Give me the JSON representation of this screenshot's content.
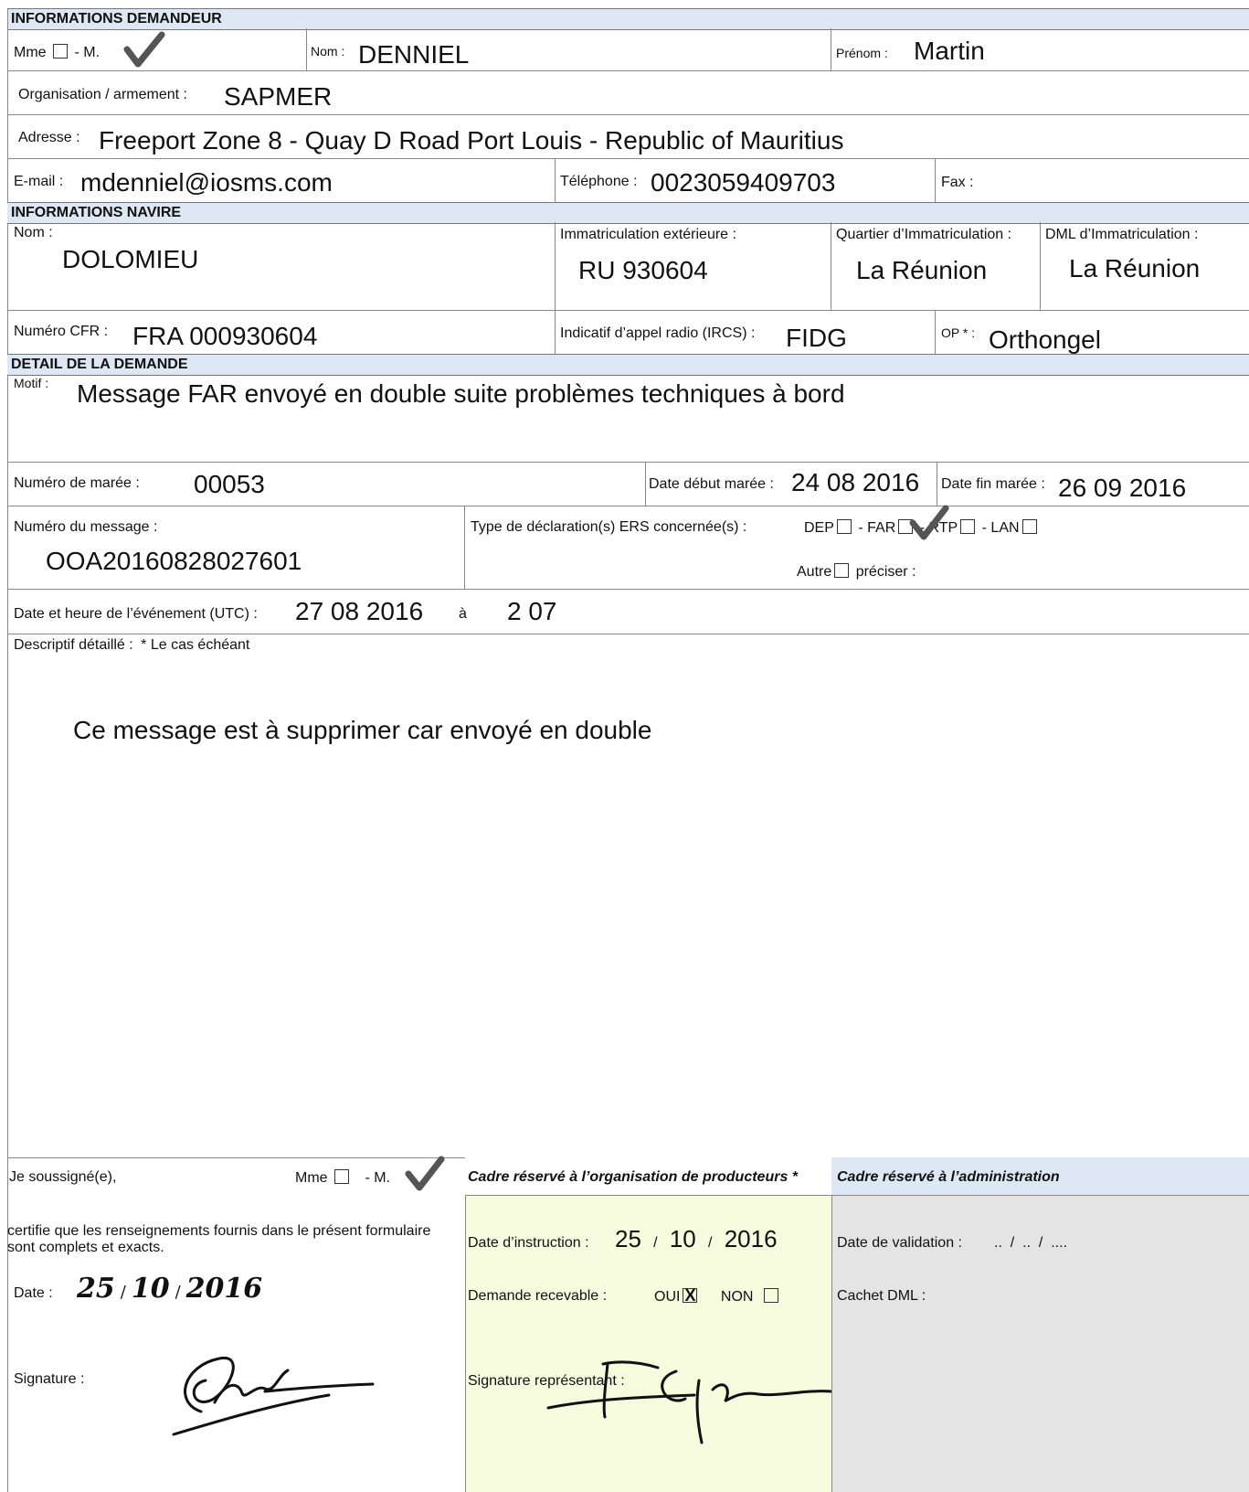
{
  "sections": {
    "demandeur": "INFORMATIONS DEMANDEUR",
    "navire": "INFORMATIONS NAVIRE",
    "demande": "DETAIL DE LA DEMANDE"
  },
  "demandeur": {
    "mme_label": "Mme",
    "m_label": "- M.",
    "nom_label": "Nom :",
    "nom": "DENNIEL",
    "prenom_label": "Prénom :",
    "prenom": "Martin",
    "organisation_label": "Organisation / armement :",
    "organisation": "SAPMER",
    "adresse_label": "Adresse :",
    "adresse": "Freeport Zone 8 - Quay D Road Port Louis - Republic of Mauritius",
    "email_label": "E-mail :",
    "email": "mdenniel@iosms.com",
    "telephone_label": "Téléphone :",
    "telephone": "0023059409703",
    "fax_label": "Fax :"
  },
  "navire": {
    "nom_label": "Nom :",
    "nom": "DOLOMIEU",
    "immat_ext_label": "Immatriculation extérieure :",
    "immat_ext": "RU 930604",
    "quartier_label": "Quartier d’Immatriculation :",
    "quartier": "La Réunion",
    "dml_label": "DML d’Immatriculation :",
    "dml": "La Réunion",
    "cfr_label": "Numéro CFR :",
    "cfr": "FRA 000930604",
    "ircs_label": "Indicatif d’appel radio (IRCS) :",
    "ircs": "FIDG",
    "op_label": "OP * :",
    "op": "Orthongel"
  },
  "demande": {
    "motif_label": "Motif :",
    "motif": "Message FAR envoyé en double suite problèmes techniques à bord",
    "maree_label": "Numéro de marée :",
    "maree": "00053",
    "debut_label": "Date début marée :",
    "debut": "24 08 2016",
    "fin_label": "Date fin marée :",
    "fin": "26 09 2016",
    "message_label": "Numéro du message :",
    "message": "OOA20160828027601",
    "type_label": "Type de déclaration(s) ERS concernée(s) :",
    "dep": "DEP",
    "far": "- FAR",
    "rtp": "- RTP",
    "lan": "- LAN",
    "autre": "Autre",
    "preciser": "préciser :",
    "event_label": "Date et heure de l’événement (UTC) :",
    "event_date": "27 08 2016",
    "a": "à",
    "event_time": "2 07",
    "descriptif_label": "Descriptif détaillé :",
    "cas_label": "* Le cas échéant",
    "descriptif": "Ce message est à supprimer car envoyé en double"
  },
  "certif": {
    "soussigne": "Je soussigné(e),",
    "mme": "Mme",
    "m": "- M.",
    "text": "certifie que les renseignements fournis dans le présent formulaire sont complets et exacts.",
    "date_label": "Date :",
    "date_d": "25",
    "date_m": "10",
    "date_y": "2016",
    "signature_label": "Signature :"
  },
  "op": {
    "title": "Cadre réservé à l’organisation de producteurs *",
    "instruction_label": "Date d’instruction :",
    "instruction_d": "25",
    "instruction_m": "10",
    "instruction_y": "2016",
    "recevable_label": "Demande recevable :",
    "oui": "OUI",
    "non": "NON",
    "signature_label": "Signature représentant :"
  },
  "admin": {
    "title": "Cadre réservé à l’administration",
    "validation_label": "Date de validation :",
    "validation_value": "..  /  ..  /  ....",
    "cachet_label": "Cachet DML :"
  },
  "colors": {
    "header_bg": "#dde8f4",
    "op_bg": "#f5fbdc",
    "admin_bg": "#e4e4e4",
    "check": "#555555"
  }
}
